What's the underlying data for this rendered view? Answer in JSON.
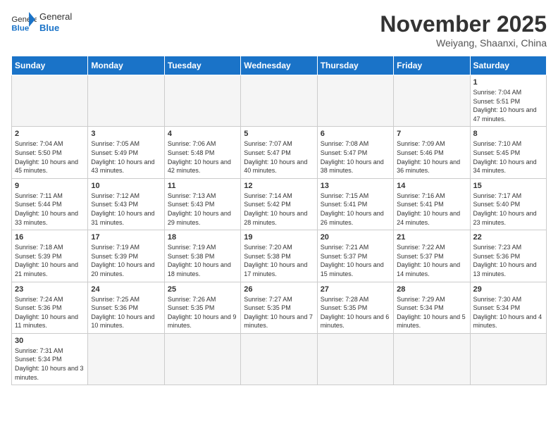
{
  "header": {
    "logo_general": "General",
    "logo_blue": "Blue",
    "title": "November 2025",
    "subtitle": "Weiyang, Shaanxi, China"
  },
  "weekdays": [
    "Sunday",
    "Monday",
    "Tuesday",
    "Wednesday",
    "Thursday",
    "Friday",
    "Saturday"
  ],
  "weeks": [
    [
      {
        "day": "",
        "info": ""
      },
      {
        "day": "",
        "info": ""
      },
      {
        "day": "",
        "info": ""
      },
      {
        "day": "",
        "info": ""
      },
      {
        "day": "",
        "info": ""
      },
      {
        "day": "",
        "info": ""
      },
      {
        "day": "1",
        "info": "Sunrise: 7:04 AM\nSunset: 5:51 PM\nDaylight: 10 hours and 47 minutes."
      }
    ],
    [
      {
        "day": "2",
        "info": "Sunrise: 7:04 AM\nSunset: 5:50 PM\nDaylight: 10 hours and 45 minutes."
      },
      {
        "day": "3",
        "info": "Sunrise: 7:05 AM\nSunset: 5:49 PM\nDaylight: 10 hours and 43 minutes."
      },
      {
        "day": "4",
        "info": "Sunrise: 7:06 AM\nSunset: 5:48 PM\nDaylight: 10 hours and 42 minutes."
      },
      {
        "day": "5",
        "info": "Sunrise: 7:07 AM\nSunset: 5:47 PM\nDaylight: 10 hours and 40 minutes."
      },
      {
        "day": "6",
        "info": "Sunrise: 7:08 AM\nSunset: 5:47 PM\nDaylight: 10 hours and 38 minutes."
      },
      {
        "day": "7",
        "info": "Sunrise: 7:09 AM\nSunset: 5:46 PM\nDaylight: 10 hours and 36 minutes."
      },
      {
        "day": "8",
        "info": "Sunrise: 7:10 AM\nSunset: 5:45 PM\nDaylight: 10 hours and 34 minutes."
      }
    ],
    [
      {
        "day": "9",
        "info": "Sunrise: 7:11 AM\nSunset: 5:44 PM\nDaylight: 10 hours and 33 minutes."
      },
      {
        "day": "10",
        "info": "Sunrise: 7:12 AM\nSunset: 5:43 PM\nDaylight: 10 hours and 31 minutes."
      },
      {
        "day": "11",
        "info": "Sunrise: 7:13 AM\nSunset: 5:43 PM\nDaylight: 10 hours and 29 minutes."
      },
      {
        "day": "12",
        "info": "Sunrise: 7:14 AM\nSunset: 5:42 PM\nDaylight: 10 hours and 28 minutes."
      },
      {
        "day": "13",
        "info": "Sunrise: 7:15 AM\nSunset: 5:41 PM\nDaylight: 10 hours and 26 minutes."
      },
      {
        "day": "14",
        "info": "Sunrise: 7:16 AM\nSunset: 5:41 PM\nDaylight: 10 hours and 24 minutes."
      },
      {
        "day": "15",
        "info": "Sunrise: 7:17 AM\nSunset: 5:40 PM\nDaylight: 10 hours and 23 minutes."
      }
    ],
    [
      {
        "day": "16",
        "info": "Sunrise: 7:18 AM\nSunset: 5:39 PM\nDaylight: 10 hours and 21 minutes."
      },
      {
        "day": "17",
        "info": "Sunrise: 7:19 AM\nSunset: 5:39 PM\nDaylight: 10 hours and 20 minutes."
      },
      {
        "day": "18",
        "info": "Sunrise: 7:19 AM\nSunset: 5:38 PM\nDaylight: 10 hours and 18 minutes."
      },
      {
        "day": "19",
        "info": "Sunrise: 7:20 AM\nSunset: 5:38 PM\nDaylight: 10 hours and 17 minutes."
      },
      {
        "day": "20",
        "info": "Sunrise: 7:21 AM\nSunset: 5:37 PM\nDaylight: 10 hours and 15 minutes."
      },
      {
        "day": "21",
        "info": "Sunrise: 7:22 AM\nSunset: 5:37 PM\nDaylight: 10 hours and 14 minutes."
      },
      {
        "day": "22",
        "info": "Sunrise: 7:23 AM\nSunset: 5:36 PM\nDaylight: 10 hours and 13 minutes."
      }
    ],
    [
      {
        "day": "23",
        "info": "Sunrise: 7:24 AM\nSunset: 5:36 PM\nDaylight: 10 hours and 11 minutes."
      },
      {
        "day": "24",
        "info": "Sunrise: 7:25 AM\nSunset: 5:36 PM\nDaylight: 10 hours and 10 minutes."
      },
      {
        "day": "25",
        "info": "Sunrise: 7:26 AM\nSunset: 5:35 PM\nDaylight: 10 hours and 9 minutes."
      },
      {
        "day": "26",
        "info": "Sunrise: 7:27 AM\nSunset: 5:35 PM\nDaylight: 10 hours and 7 minutes."
      },
      {
        "day": "27",
        "info": "Sunrise: 7:28 AM\nSunset: 5:35 PM\nDaylight: 10 hours and 6 minutes."
      },
      {
        "day": "28",
        "info": "Sunrise: 7:29 AM\nSunset: 5:34 PM\nDaylight: 10 hours and 5 minutes."
      },
      {
        "day": "29",
        "info": "Sunrise: 7:30 AM\nSunset: 5:34 PM\nDaylight: 10 hours and 4 minutes."
      }
    ],
    [
      {
        "day": "30",
        "info": "Sunrise: 7:31 AM\nSunset: 5:34 PM\nDaylight: 10 hours and 3 minutes."
      },
      {
        "day": "",
        "info": ""
      },
      {
        "day": "",
        "info": ""
      },
      {
        "day": "",
        "info": ""
      },
      {
        "day": "",
        "info": ""
      },
      {
        "day": "",
        "info": ""
      },
      {
        "day": "",
        "info": ""
      }
    ]
  ]
}
